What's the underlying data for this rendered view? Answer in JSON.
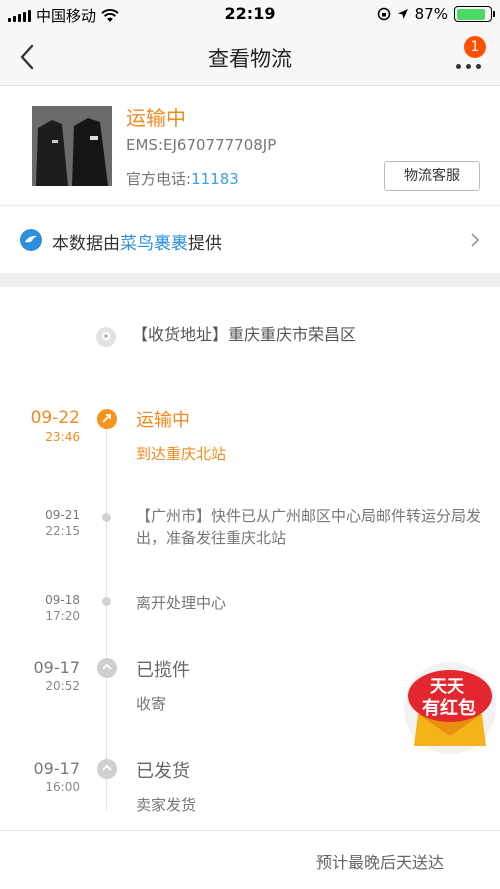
{
  "status_bar": {
    "carrier": "中国移动",
    "time": "22:19",
    "battery_text": "87%",
    "battery_level": 0.87
  },
  "nav": {
    "title": "查看物流",
    "badge_count": "1"
  },
  "package": {
    "status": "运输中",
    "tracking_no": "EMS:EJ670777708JP",
    "phone_label": "官方电话:",
    "phone_number": "11183",
    "service_button": "物流客服"
  },
  "provider": {
    "prefix": "本数据由",
    "brand": "菜鸟裹裹",
    "suffix": "提供"
  },
  "address": {
    "text": "【收货地址】重庆重庆市荣昌区"
  },
  "events": [
    {
      "date": "09-22",
      "time": "23:46",
      "title": "运输中",
      "desc": "到达重庆北站"
    },
    {
      "date": "09-21",
      "time": "22:15",
      "desc": "【广州市】快件已从广州邮区中心局邮件转运分局发出，准备发往重庆北站"
    },
    {
      "date": "09-18",
      "time": "17:20",
      "desc": "离开处理中心"
    },
    {
      "date": "09-17",
      "time": "20:52",
      "title": "已揽件",
      "desc": "收寄"
    },
    {
      "date": "09-17",
      "time": "16:00",
      "title": "已发货",
      "desc": "卖家发货"
    }
  ],
  "promo": {
    "line1": "天天",
    "line2": "有红包"
  },
  "footer": {
    "text": "预计最晚后天送达"
  },
  "colors": {
    "accent": "#f08a1e",
    "link": "#2d8fdd",
    "badge": "#ff5000"
  },
  "icons": [
    "signal-icon",
    "wifi-icon",
    "lock-rotation-icon",
    "location-arrow-icon",
    "battery-icon",
    "back-chevron-icon",
    "more-icon",
    "cainiao-icon",
    "chevron-right-icon",
    "address-pin-icon",
    "truck-icon",
    "package-icon",
    "red-packet-icon"
  ]
}
